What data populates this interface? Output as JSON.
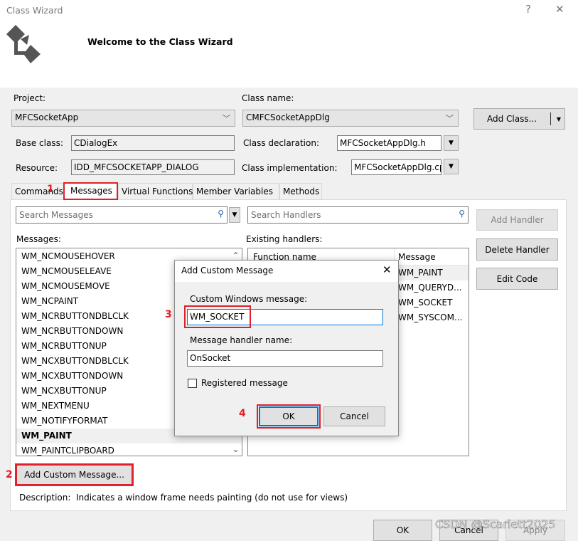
{
  "window": {
    "title": "Class Wizard",
    "help": "?",
    "close": "✕",
    "welcome": "Welcome to the Class Wizard"
  },
  "form": {
    "project_label": "Project:",
    "project_value": "MFCSocketApp",
    "class_name_label": "Class name:",
    "class_name_value": "CMFCSocketAppDlg",
    "add_class": "Add Class...",
    "base_class_label": "Base class:",
    "base_class_value": "CDialogEx",
    "class_decl_label": "Class declaration:",
    "class_decl_value": "MFCSocketAppDlg.h",
    "resource_label": "Resource:",
    "resource_value": "IDD_MFCSOCKETAPP_DIALOG",
    "class_impl_label": "Class implementation:",
    "class_impl_value": "MFCSocketAppDlg.cp"
  },
  "tabs": [
    {
      "label": "Commands"
    },
    {
      "label": "Messages"
    },
    {
      "label": "Virtual Functions"
    },
    {
      "label": "Member Variables"
    },
    {
      "label": "Methods"
    }
  ],
  "messages": {
    "search_placeholder": "Search Messages",
    "search_handlers_placeholder": "Search Handlers",
    "messages_label": "Messages:",
    "handlers_label": "Existing handlers:",
    "items": [
      "WM_NCMOUSEHOVER",
      "WM_NCMOUSELEAVE",
      "WM_NCMOUSEMOVE",
      "WM_NCPAINT",
      "WM_NCRBUTTONDBLCLK",
      "WM_NCRBUTTONDOWN",
      "WM_NCRBUTTONUP",
      "WM_NCXBUTTONDBLCLK",
      "WM_NCXBUTTONDOWN",
      "WM_NCXBUTTONUP",
      "WM_NEXTMENU",
      "WM_NOTIFYFORMAT",
      "WM_PAINT",
      "WM_PAINTCLIPBOARD"
    ],
    "selected": "WM_PAINT",
    "handler_cols": [
      "Function name",
      "Message"
    ],
    "handler_messages": [
      "WM_PAINT",
      "WM_QUERYD...",
      "WM_SOCKET",
      "WM_SYSCOM..."
    ],
    "add_handler": "Add Handler",
    "delete_handler": "Delete Handler",
    "edit_code": "Edit Code",
    "add_custom": "Add Custom Message...",
    "description_label": "Description:",
    "description": "Indicates a window frame needs painting (do not use for views)"
  },
  "footer": {
    "ok": "OK",
    "cancel": "Cancel",
    "apply": "Apply",
    "watermark": "CSDN @Scarlett2025"
  },
  "annotations": [
    "1",
    "2",
    "3",
    "4"
  ],
  "dialog": {
    "title": "Add Custom Message",
    "close": "✕",
    "custom_label": "Custom Windows message:",
    "custom_value": "WM_SOCKET",
    "handler_label": "Message handler name:",
    "handler_value": "OnSocket",
    "registered_label": "Registered message",
    "registered_checked": false,
    "ok": "OK",
    "cancel": "Cancel"
  }
}
